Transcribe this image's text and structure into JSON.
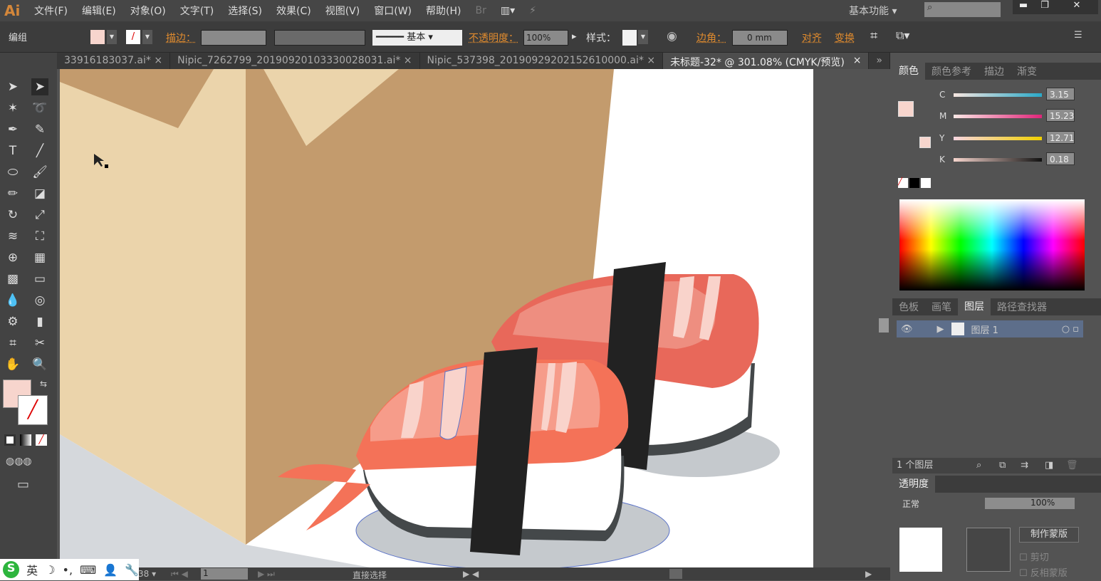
{
  "app": {
    "logo": "Ai",
    "workspace": "基本功能"
  },
  "menu": [
    "文件(F)",
    "编辑(E)",
    "对象(O)",
    "文字(T)",
    "选择(S)",
    "效果(C)",
    "视图(V)",
    "窗口(W)",
    "帮助(H)"
  ],
  "control": {
    "selection": "编组",
    "stroke_label": "描边：",
    "stroke_style": "基本",
    "opacity_label": "不透明度：",
    "opacity": "100%",
    "style_label": "样式：",
    "corner_label": "边角：",
    "corner_value": "0 mm",
    "align": "对齐",
    "transform": "变换",
    "fill_color": "#f7d5cd"
  },
  "tabs": [
    {
      "label": "33916183037.ai*"
    },
    {
      "label": "Nipic_7262799_20190920103330028031.ai*"
    },
    {
      "label": "Nipic_537398_20190929202152610000.ai*"
    },
    {
      "label": "未标题-32* @ 301.08% (CMYK/预览)",
      "active": true
    }
  ],
  "color_panel": {
    "tabs": [
      "颜色",
      "颜色参考",
      "描边",
      "渐变"
    ],
    "channels": [
      {
        "name": "C",
        "value": "3.15",
        "color": "#29a9c8"
      },
      {
        "name": "M",
        "value": "15.23",
        "color": "#e0257a"
      },
      {
        "name": "Y",
        "value": "12.71",
        "color": "#f0d000"
      },
      {
        "name": "K",
        "value": "0.18",
        "color": "#111111"
      }
    ]
  },
  "layers_panel": {
    "tabs": [
      "色板",
      "画笔",
      "图层",
      "路径查找器"
    ],
    "layer": "图层 1",
    "count": "1 个图层"
  },
  "transparency_panel": {
    "title": "透明度",
    "mode": "正常",
    "opacity": "100%",
    "make_mask": "制作蒙版",
    "clip": "剪切",
    "invert": "反相蒙版"
  },
  "status": {
    "zoom": "38",
    "artboard": "1",
    "tool": "直接选择"
  },
  "ime": {
    "lang": "英"
  }
}
